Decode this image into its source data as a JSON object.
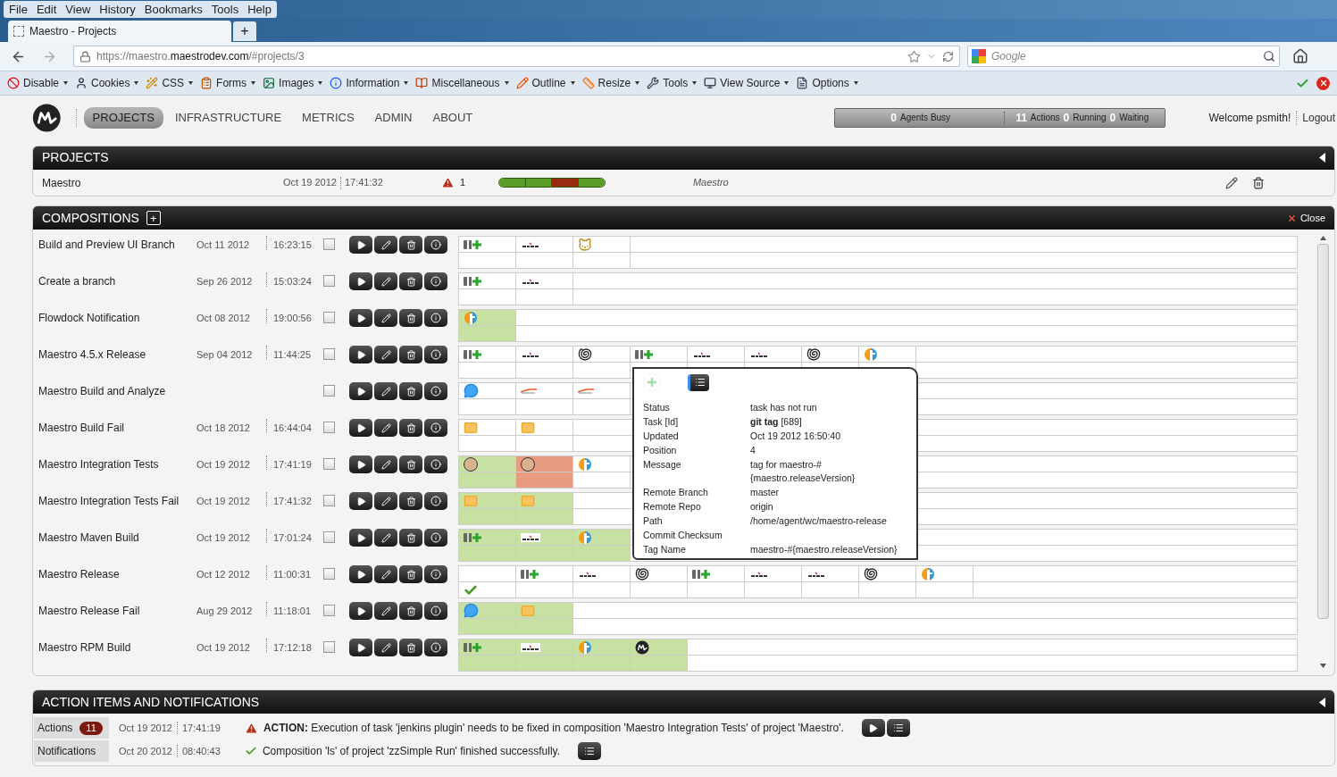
{
  "browser": {
    "menu": [
      "File",
      "Edit",
      "View",
      "History",
      "Bookmarks",
      "Tools",
      "Help"
    ],
    "tab": {
      "title": "Maestro - Projects",
      "new_tab": "+"
    },
    "url": {
      "prefix": "https://maestro.",
      "domain": "maestrodev.com",
      "path": "/#projects/3"
    },
    "search": {
      "placeholder": "Google"
    },
    "toolbar": [
      "Disable",
      "Cookies",
      "CSS",
      "Forms",
      "Images",
      "Information",
      "Miscellaneous",
      "Outline",
      "Resize",
      "Tools",
      "View Source",
      "Options"
    ]
  },
  "nav": {
    "items": [
      {
        "label": "PROJECTS",
        "selected": true
      },
      {
        "label": "INFRASTRUCTURE",
        "selected": false
      },
      {
        "label": "METRICS",
        "selected": false
      },
      {
        "label": "ADMIN",
        "selected": false
      },
      {
        "label": "ABOUT",
        "selected": false
      }
    ],
    "status": [
      {
        "count": "0",
        "label": "Agents Busy"
      },
      {
        "count": "11",
        "label": "Actions"
      },
      {
        "count": "0",
        "label": "Running"
      },
      {
        "count": "0",
        "label": "Waiting"
      }
    ],
    "welcome": "Welcome psmith!",
    "logout": "Logout"
  },
  "projects": {
    "title": "PROJECTS",
    "rows": [
      {
        "name": "Maestro",
        "date": "Oct 19 2012",
        "time": "17:41:32",
        "warnings": "1",
        "owner": "Maestro",
        "health": [
          {
            "color": "#5a9e28"
          },
          {
            "color": "#5a9e28"
          },
          {
            "color": "#9b2a12"
          },
          {
            "color": "#5a9e28"
          }
        ]
      }
    ]
  },
  "compositions": {
    "title": "COMPOSITIONS",
    "add": "+",
    "close": "Close",
    "rows": [
      {
        "name": "Build and Preview UI Branch",
        "date": "Oct 11 2012",
        "time": "16:23:15",
        "checked": false,
        "tasks": [
          {
            "kind": "git",
            "color": "#ffffff"
          },
          {
            "kind": "maven",
            "color": "#ffffff"
          },
          {
            "kind": "tomcat",
            "color": "#ffffff"
          }
        ]
      },
      {
        "name": "Create a branch",
        "date": "Sep 26 2012",
        "time": "15:03:24",
        "checked": false,
        "tasks": [
          {
            "kind": "git",
            "color": "#ffffff"
          },
          {
            "kind": "maven",
            "color": "#ffffff"
          }
        ]
      },
      {
        "name": "Flowdock Notification",
        "date": "Oct 08 2012",
        "time": "19:00:56",
        "checked": false,
        "tasks": [
          {
            "kind": "flowdock",
            "color": "#c7e1a3"
          }
        ]
      },
      {
        "name": "Maestro 4.5.x Release",
        "date": "Sep 04 2012",
        "time": "11:44:25",
        "checked": false,
        "tasks": [
          {
            "kind": "git",
            "color": "#ffffff"
          },
          {
            "kind": "maven",
            "color": "#ffffff"
          },
          {
            "kind": "shell",
            "color": "#ffffff"
          },
          {
            "kind": "git",
            "color": "#ffffff"
          },
          {
            "kind": "maven",
            "color": "#ffffff"
          },
          {
            "kind": "maven",
            "color": "#ffffff"
          },
          {
            "kind": "shell",
            "color": "#ffffff"
          },
          {
            "kind": "flowdock",
            "color": "#ffffff"
          }
        ]
      },
      {
        "name": "Maestro Build and Analyze",
        "checked": false,
        "tasks": [
          {
            "kind": "campfire",
            "color": "#ffffff"
          },
          {
            "kind": "continuum",
            "color": "#ffffff"
          },
          {
            "kind": "continuum",
            "color": "#ffffff"
          }
        ]
      },
      {
        "name": "Maestro Build Fail",
        "date": "Oct 18 2012",
        "time": "16:44:04",
        "checked": false,
        "tasks": [
          {
            "kind": "email",
            "color": "#ffffff"
          },
          {
            "kind": "email",
            "color": "#ffffff"
          }
        ]
      },
      {
        "name": "Maestro Integration Tests",
        "date": "Oct 19 2012",
        "time": "17:41:19",
        "checked": false,
        "tasks": [
          {
            "kind": "jenkins",
            "color": "#c7e1a3"
          },
          {
            "kind": "jenkins",
            "color": "#e99b7f"
          },
          {
            "kind": "flowdock",
            "color": "#ffffff"
          }
        ]
      },
      {
        "name": "Maestro Integration Tests Fail",
        "date": "Oct 19 2012",
        "time": "17:41:32",
        "checked": false,
        "tasks": [
          {
            "kind": "email",
            "color": "#c7e1a3"
          },
          {
            "kind": "email",
            "color": "#c7e1a3"
          }
        ]
      },
      {
        "name": "Maestro Maven Build",
        "date": "Oct 19 2012",
        "time": "17:01:24",
        "checked": false,
        "tasks": [
          {
            "kind": "git",
            "color": "#c7e1a3"
          },
          {
            "kind": "maven",
            "color": "#c7e1a3"
          },
          {
            "kind": "flowdock",
            "color": "#c7e1a3"
          }
        ]
      },
      {
        "name": "Maestro Release",
        "date": "Oct 12 2012",
        "time": "11:00:31",
        "checked": false,
        "tasks": [
          {
            "kind": "done",
            "color": "#ffffff"
          },
          {
            "kind": "git",
            "color": "#ffffff"
          },
          {
            "kind": "maven",
            "color": "#ffffff"
          },
          {
            "kind": "shell",
            "color": "#ffffff"
          },
          {
            "kind": "git",
            "color": "#ffffff"
          },
          {
            "kind": "maven",
            "color": "#ffffff"
          },
          {
            "kind": "maven",
            "color": "#ffffff"
          },
          {
            "kind": "shell",
            "color": "#ffffff"
          },
          {
            "kind": "flowdock",
            "color": "#ffffff"
          }
        ]
      },
      {
        "name": "Maestro Release Fail",
        "date": "Aug 29 2012",
        "time": "11:18:01",
        "checked": false,
        "tasks": [
          {
            "kind": "campfire",
            "color": "#c7e1a3"
          },
          {
            "kind": "email",
            "color": "#c7e1a3"
          }
        ]
      },
      {
        "name": "Maestro RPM Build",
        "date": "Oct 19 2012",
        "time": "17:12:18",
        "checked": false,
        "tasks": [
          {
            "kind": "git",
            "color": "#c7e1a3"
          },
          {
            "kind": "maven",
            "color": "#c7e1a3"
          },
          {
            "kind": "flowdock",
            "color": "#c7e1a3"
          },
          {
            "kind": "maestro",
            "color": "#c7e1a3"
          }
        ]
      }
    ],
    "popup": {
      "fields": [
        {
          "label": "Status",
          "value": "task has not run"
        },
        {
          "label": "Task [Id]",
          "value": "**git tag** [689]"
        },
        {
          "label": "Updated",
          "value": "Oct 19 2012 16:50:40"
        },
        {
          "label": "Position",
          "value": "4"
        },
        {
          "label": "Message",
          "value": "tag for maestro-#\n{maestro.releaseVersion}"
        },
        {
          "label": "Remote Branch",
          "value": "master"
        },
        {
          "label": "Remote Repo",
          "value": "origin"
        },
        {
          "label": "Path",
          "value": "/home/agent/wc/maestro-release"
        },
        {
          "label": "Commit Checksum"
        },
        {
          "label": "Tag Name",
          "value": "maestro-#{maestro.releaseVersion}"
        }
      ]
    }
  },
  "actions": {
    "title": "ACTION ITEMS AND NOTIFICATIONS",
    "tabs": [
      {
        "label": "Actions",
        "badge": "11"
      },
      {
        "label": "Notifications"
      }
    ],
    "items": [
      {
        "kind": "action",
        "date": "Oct 19 2012",
        "time": "17:41:19",
        "text": "**ACTION:** Execution of task 'jenkins plugin' needs to be fixed in composition 'Maestro Integration Tests' of project 'Maestro'."
      },
      {
        "kind": "notification",
        "date": "Oct 20 2012",
        "time": "08:40:43",
        "text": "Composition 'ls' of project 'zzSimple Run' finished successfully."
      }
    ]
  }
}
